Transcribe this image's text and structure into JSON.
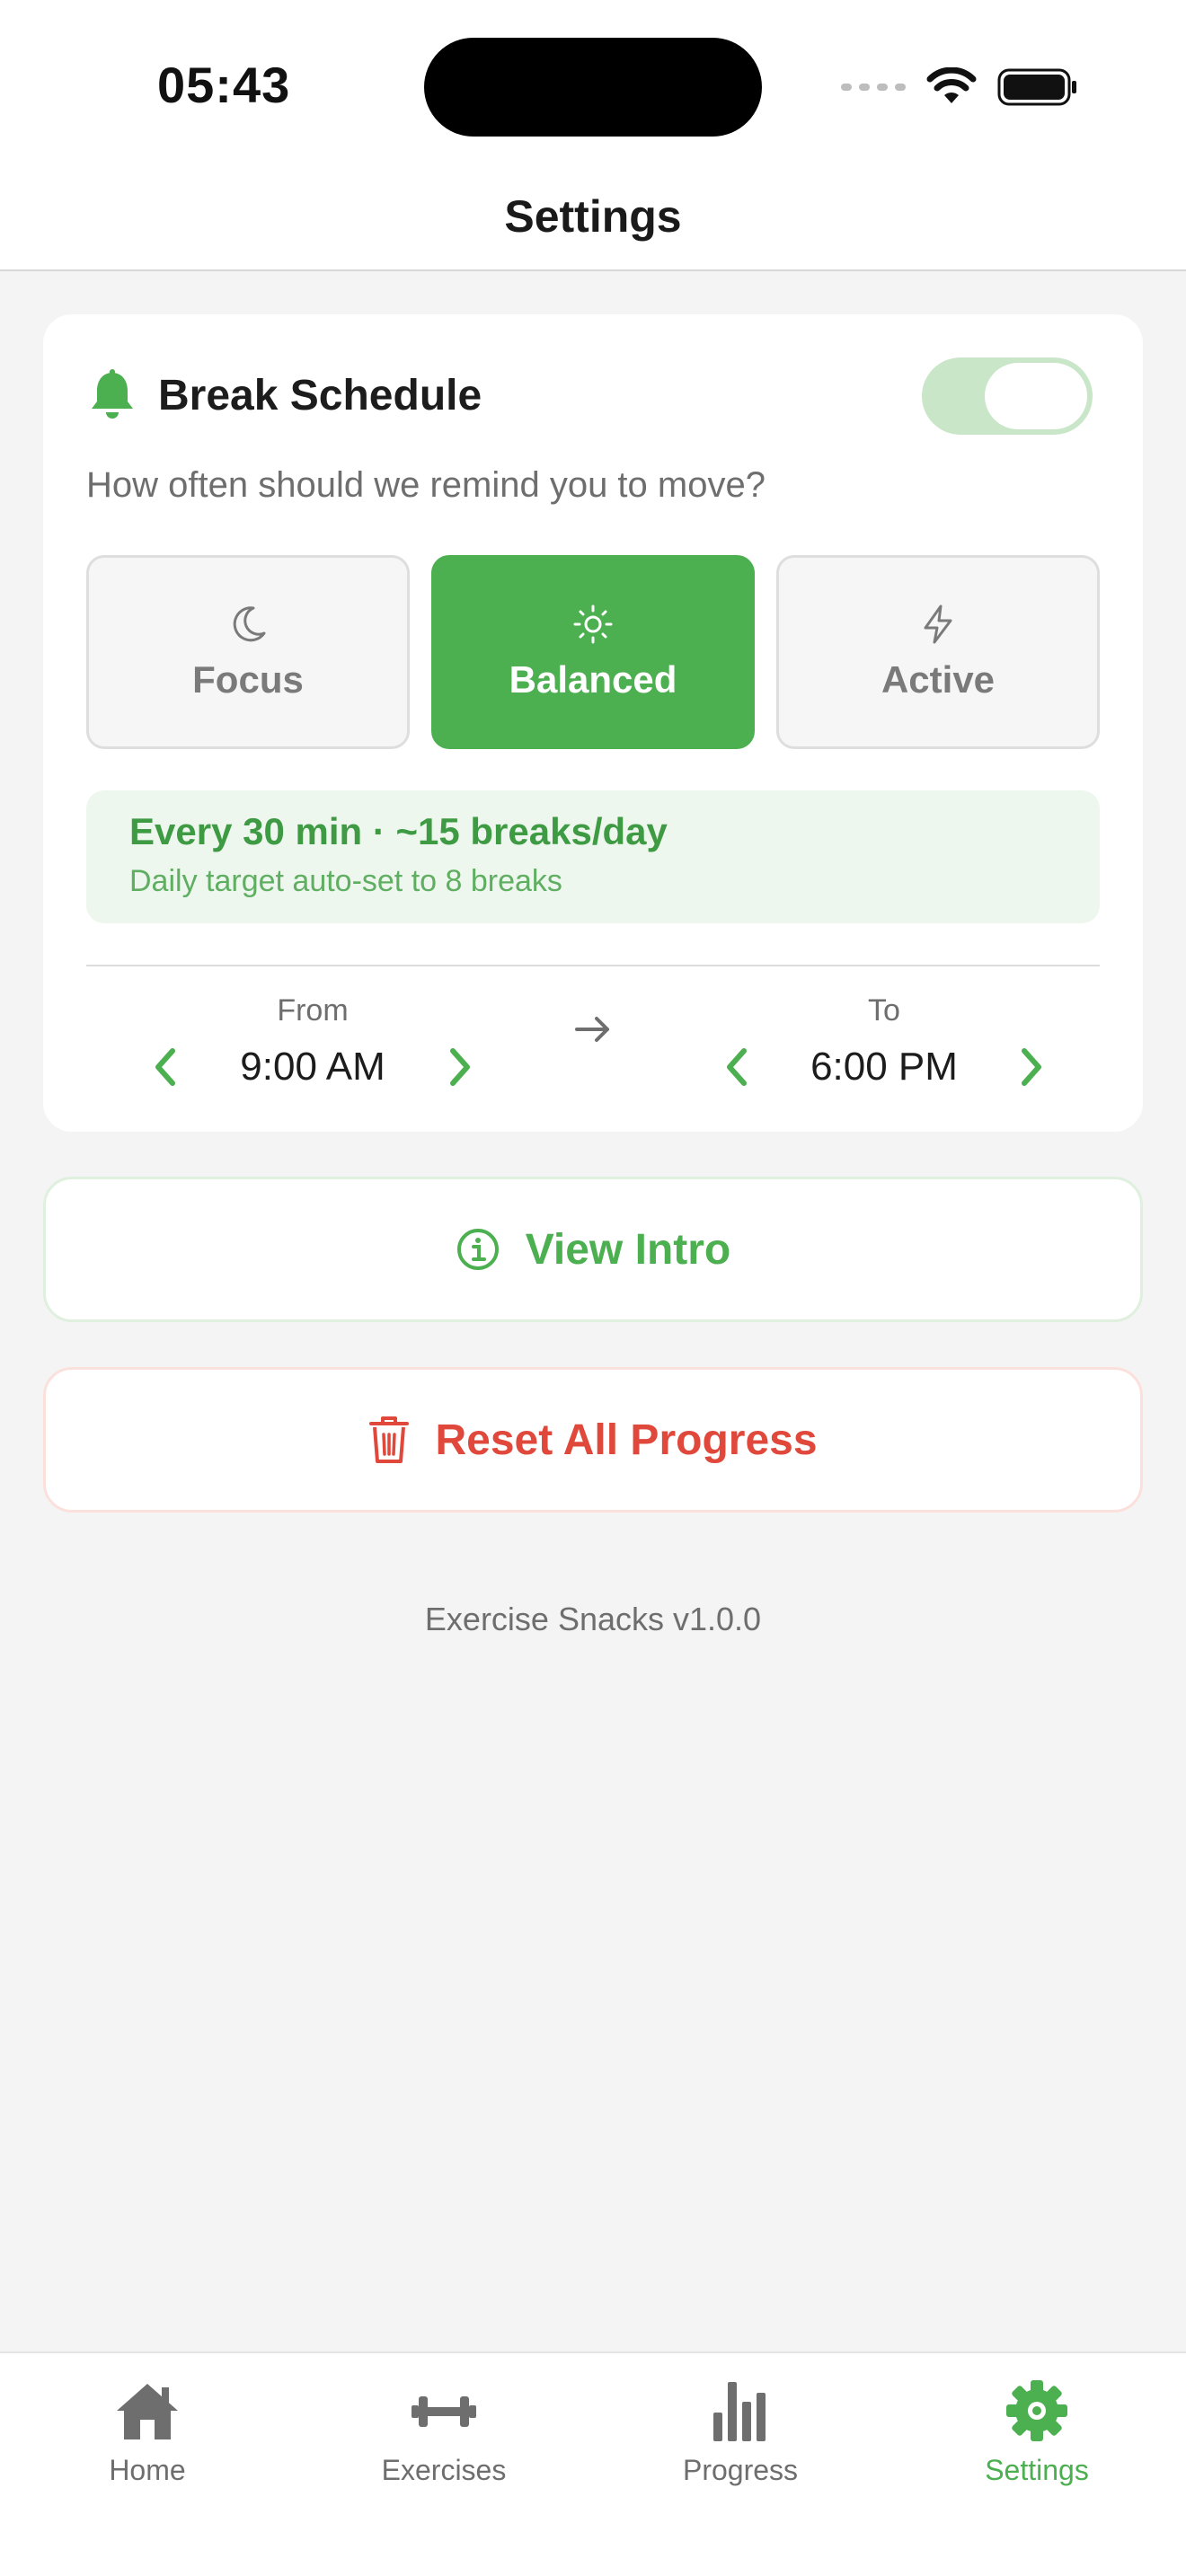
{
  "status_bar": {
    "time": "05:43"
  },
  "header": {
    "title": "Settings"
  },
  "schedule": {
    "title": "Break Schedule",
    "enabled": true,
    "subtitle": "How often should we remind you to move?",
    "modes": [
      {
        "label": "Focus",
        "icon": "moon-icon",
        "selected": false
      },
      {
        "label": "Balanced",
        "icon": "sun-icon",
        "selected": true
      },
      {
        "label": "Active",
        "icon": "lightning-icon",
        "selected": false
      }
    ],
    "summary": "Every 30 min  ·  ~15 breaks/day",
    "summary_note": "Daily target auto-set to 8 breaks",
    "from_label": "From",
    "from_value": "9:00 AM",
    "to_label": "To",
    "to_value": "6:00 PM"
  },
  "actions": {
    "view_intro": "View Intro",
    "reset": "Reset All Progress"
  },
  "version": "Exercise Snacks v1.0.0",
  "tabs": [
    {
      "label": "Home",
      "icon": "home-icon"
    },
    {
      "label": "Exercises",
      "icon": "dumbbell-icon"
    },
    {
      "label": "Progress",
      "icon": "bar-chart-icon"
    },
    {
      "label": "Settings",
      "icon": "gear-icon",
      "active": true
    }
  ],
  "colors": {
    "accent": "#4caf50",
    "danger": "#e0483c",
    "info_bg": "#eef7ee",
    "background": "#f4f4f4"
  }
}
